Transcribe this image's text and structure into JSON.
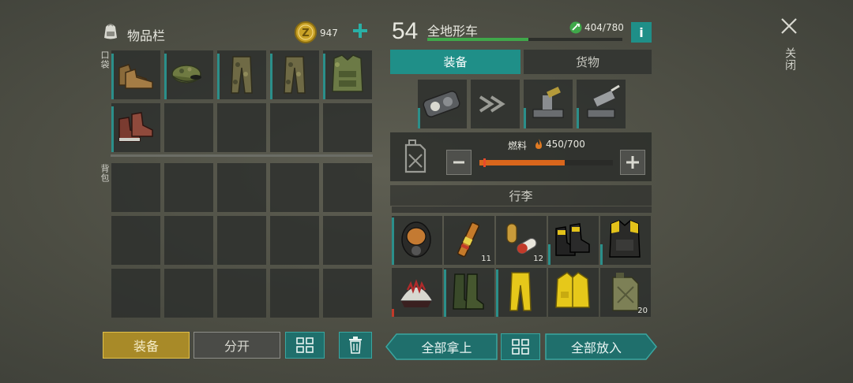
{
  "inventory": {
    "title": "物品栏",
    "coins": "947",
    "pockets_label": "口袋",
    "backpack_label": "背包",
    "pocket_items": [
      {
        "icon": "leather-boots-icon"
      },
      {
        "icon": "camo-cap-icon"
      },
      {
        "icon": "camo-pants-icon"
      },
      {
        "icon": "camo-pants-icon"
      },
      {
        "icon": "camo-vest-icon"
      },
      {
        "icon": "red-boots-icon"
      }
    ],
    "buttons": {
      "equip": "装备",
      "split": "分开"
    }
  },
  "vehicle": {
    "level": "54",
    "name": "全地形车",
    "durability": "404/780",
    "durability_fraction": 0.52,
    "tabs": {
      "equipment": "装备",
      "cargo": "货物"
    },
    "fuel_label": "燃料",
    "fuel_value": "450/700",
    "fuel_fraction": 0.64,
    "luggage_label": "行李",
    "luggage_items": [
      {
        "icon": "gas-mask-icon",
        "count": ""
      },
      {
        "icon": "syringe-icon",
        "count": "11"
      },
      {
        "icon": "pills-icon",
        "count": "12"
      },
      {
        "icon": "black-yellow-boots-icon",
        "count": ""
      },
      {
        "icon": "yellow-armor-vest-icon",
        "count": ""
      },
      {
        "icon": "spiked-helmet-icon",
        "count": ""
      },
      {
        "icon": "rubber-boots-icon",
        "count": ""
      },
      {
        "icon": "yellow-pants-icon",
        "count": ""
      },
      {
        "icon": "yellow-jacket-icon",
        "count": ""
      },
      {
        "icon": "jerrycan-icon",
        "count": "20"
      }
    ],
    "buttons": {
      "take_all": "全部拿上",
      "put_all": "全部放入"
    }
  },
  "close_label": "关闭",
  "colors": {
    "teal": "#1f6f6c",
    "gold": "#b89a2e",
    "orange": "#d9661c",
    "green": "#3fa84a"
  }
}
